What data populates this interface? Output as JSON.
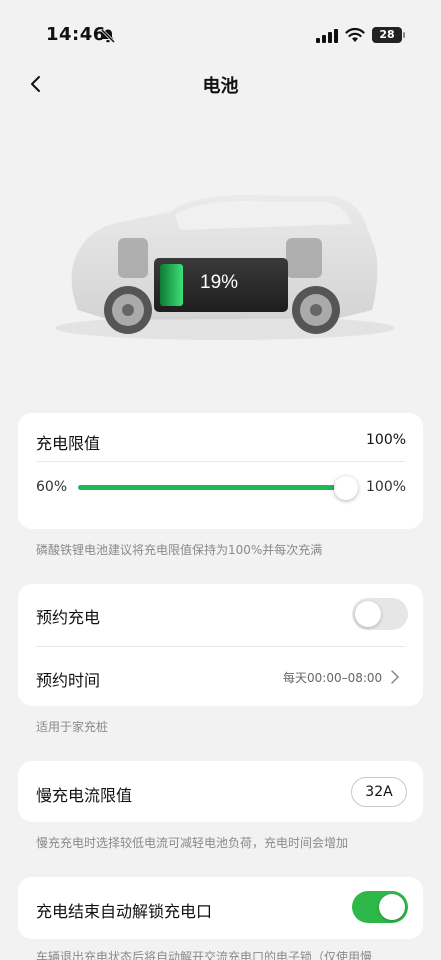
{
  "status_bar": {
    "time": "14:46",
    "battery": "28"
  },
  "nav": {
    "title": "电池"
  },
  "battery_display": {
    "percent_label": "19%",
    "level": 0.19
  },
  "charge_limit": {
    "label": "充电限值",
    "value": "100%",
    "min_label": "60%",
    "max_label": "100%",
    "slider_level": 1.0,
    "hint": "磷酸铁锂电池建议将充电限值保持为100%并每次充满"
  },
  "scheduled_charge": {
    "label": "预约充电",
    "enabled": false,
    "time_label": "预约时间",
    "time_value": "每天00:00–08:00",
    "hint": "适用于家充桩"
  },
  "slow_charge": {
    "label": "慢充电流限值",
    "value": "32A",
    "hint": "慢充充电时选择较低电流可减轻电池负荷，充电时间会增加"
  },
  "auto_unlock": {
    "label": "充电结束自动解锁充电口",
    "enabled": true,
    "hint": "车辆退出充电状态后将自动解开交流充电口的电子锁（仅使用慢"
  },
  "colors": {
    "accent_green": "#1db954",
    "toggle_on": "#2fb84a"
  }
}
